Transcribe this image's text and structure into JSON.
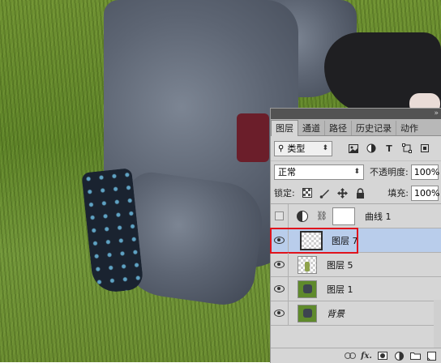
{
  "panel": {
    "tabs": [
      "图层",
      "通道",
      "路径",
      "历史记录",
      "动作"
    ],
    "active_tab_index": 0,
    "filter": {
      "kind_label": "类型",
      "icons": [
        "image-filter-icon",
        "adjustment-filter-icon",
        "text-filter-icon",
        "shape-filter-icon",
        "smart-object-filter-icon"
      ]
    },
    "blend_mode": "正常",
    "opacity_label": "不透明度:",
    "opacity_value": "100%",
    "lock_label": "锁定:",
    "fill_label": "填充:",
    "fill_value": "100%",
    "layers": [
      {
        "name": "曲线 1",
        "visible": false,
        "type": "adjustment",
        "selected": false
      },
      {
        "name": "图层 7",
        "visible": true,
        "type": "transparent",
        "selected": true
      },
      {
        "name": "图层 5",
        "visible": true,
        "type": "transparent-green",
        "selected": false
      },
      {
        "name": "图层 1",
        "visible": true,
        "type": "photo",
        "selected": false
      },
      {
        "name": "背景",
        "visible": true,
        "type": "photo",
        "selected": false
      }
    ],
    "highlight_color": "#e0141c",
    "selected_color": "#b9cdeb",
    "bottom_icons": [
      "link-layers-icon",
      "fx-icon",
      "add-mask-icon",
      "new-adjustment-icon",
      "new-group-icon",
      "new-layer-icon"
    ],
    "fx_label": "fx."
  }
}
